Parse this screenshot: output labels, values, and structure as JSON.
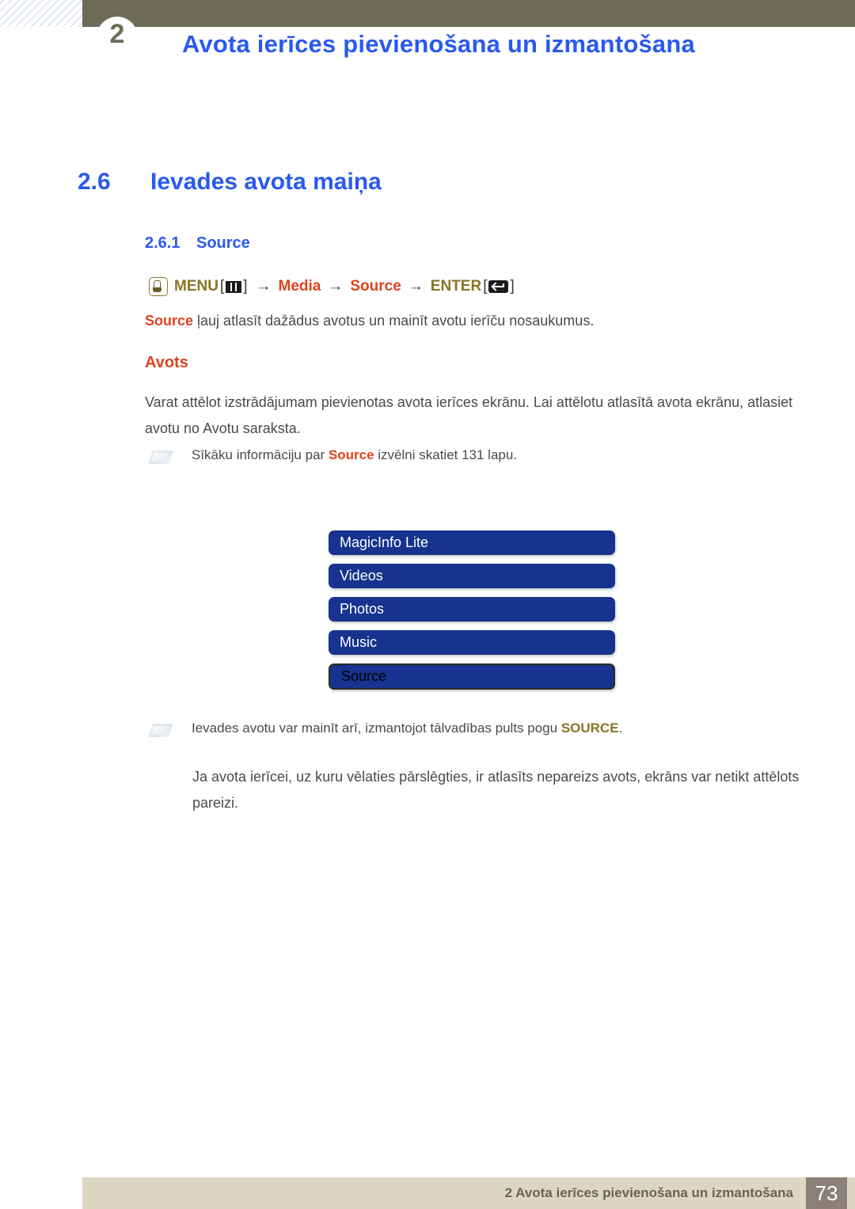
{
  "header": {
    "chapter_number": "2",
    "title": "Avota ierīces pievienošana un izmantošana"
  },
  "section": {
    "number": "2.6",
    "title": "Ievades avota maiņa"
  },
  "subsection": {
    "number": "2.6.1",
    "title": "Source"
  },
  "menu_path": {
    "press_icon": "hand-press-icon",
    "menu_label": "MENU",
    "menu_icon": "menu-bars-icon",
    "bracket_open": "[",
    "bracket_close": "]",
    "arrow": "→",
    "step_media": "Media",
    "step_source": "Source",
    "enter_label": "ENTER",
    "enter_icon": "enter-key-icon"
  },
  "intro": {
    "keyword": "Source",
    "text": " ļauj atlasīt dažādus avotus un mainīt avotu ierīču nosaukumus."
  },
  "avots": {
    "heading": "Avots",
    "description": "Varat attēlot izstrādājumam pievienotas avota ierīces ekrānu. Lai attēlotu atlasītā avota ekrānu, atlasiet avotu no Avotu saraksta."
  },
  "notes": [
    {
      "icon": "note-icon",
      "text_before": "Sīkāku informāciju par ",
      "keyword": "Source",
      "keyword_style": "red",
      "text_after": " izvēlni skatiet 131 lapu."
    },
    {
      "icon": "note-icon",
      "text_before": "Ievades avotu var mainīt arī, izmantojot tālvadības pults pogu ",
      "keyword": "SOURCE",
      "keyword_style": "olive",
      "text_after": "."
    }
  ],
  "note_detail": "Ja avota ierīcei, uz kuru vēlaties pārslēgties, ir atlasīts nepareizs avots, ekrāns var netikt attēlots pareizi.",
  "osd_menu": {
    "items": [
      {
        "label": "MagicInfo Lite",
        "selected": false
      },
      {
        "label": "Videos",
        "selected": false
      },
      {
        "label": "Photos",
        "selected": false
      },
      {
        "label": "Music",
        "selected": false
      },
      {
        "label": "Source",
        "selected": true
      }
    ]
  },
  "footer": {
    "text": "2 Avota ierīces pievienošana un izmantošana",
    "page_number": "73"
  },
  "colors": {
    "header_band": "#6d6b56",
    "title_blue": "#2a59ef",
    "accent_red": "#e0431c",
    "accent_olive": "#8a7324",
    "osd_blue": "#15338f",
    "footer_bar": "#ddd6c3",
    "footer_page_box": "#8b7f77"
  }
}
